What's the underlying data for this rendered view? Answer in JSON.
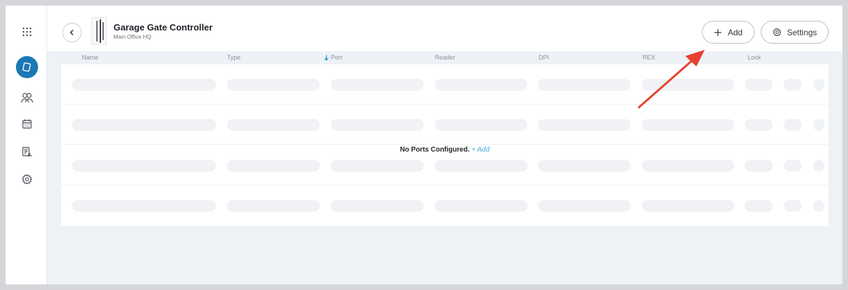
{
  "header": {
    "title": "Garage Gate Controller",
    "subtitle": "Main Office HQ",
    "add_label": "Add",
    "settings_label": "Settings"
  },
  "sidebar": {
    "items": [
      {
        "icon": "apps-grid-icon",
        "active": false
      },
      {
        "icon": "badge-card-icon",
        "active": true
      },
      {
        "icon": "users-icon",
        "active": false
      },
      {
        "icon": "calendar-icon",
        "active": false
      },
      {
        "icon": "reports-icon",
        "active": false
      },
      {
        "icon": "gear-icon",
        "active": false
      }
    ]
  },
  "table": {
    "columns": [
      "Name",
      "Type",
      "Port",
      "Reader",
      "DPI",
      "REX",
      "Lock"
    ],
    "sort_column": "Port",
    "sort_direction": "descending",
    "empty_message": "No Ports Configured.",
    "empty_add_link": "+ Add"
  },
  "colors": {
    "accent": "#1a78b4",
    "link": "#3fa9d6",
    "annotation_arrow": "#e8412e"
  }
}
